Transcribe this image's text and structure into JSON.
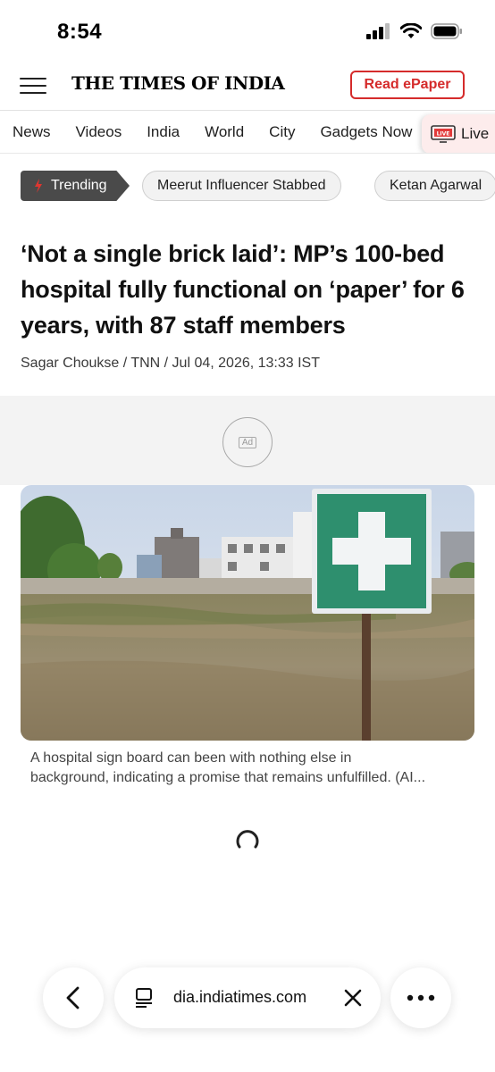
{
  "status_bar": {
    "time": "8:54"
  },
  "header": {
    "logo": "THE TIMES OF INDIA",
    "epaper_label": "Read ePaper"
  },
  "nav": {
    "items": [
      "News",
      "Videos",
      "India",
      "World",
      "City",
      "Gadgets Now"
    ],
    "live_label": "Live"
  },
  "trending": {
    "label": "Trending",
    "chips": [
      "Meerut Influencer Stabbed",
      "Ketan Agarwal"
    ]
  },
  "article": {
    "headline": "‘Not a single brick laid’: MP’s 100-bed hospital fully functional on ‘paper’ for 6 years, with 87 staff members",
    "byline": "Sagar Choukse / TNN / Jul 04, 2026, 13:33 IST",
    "image_sign_icon": "green-cross-sign",
    "caption_line1": "A hospital sign board can been with nothing else in",
    "caption_line2": "background, indicating a promise that remains unfulfilled. (AI..."
  },
  "ad": {
    "label": "Ad"
  },
  "browser": {
    "url": "dia.indiatimes.com"
  },
  "colors": {
    "brand_red": "#d52b2b",
    "trending_bg": "#4a4a4a",
    "live_bg": "#fdecec"
  }
}
